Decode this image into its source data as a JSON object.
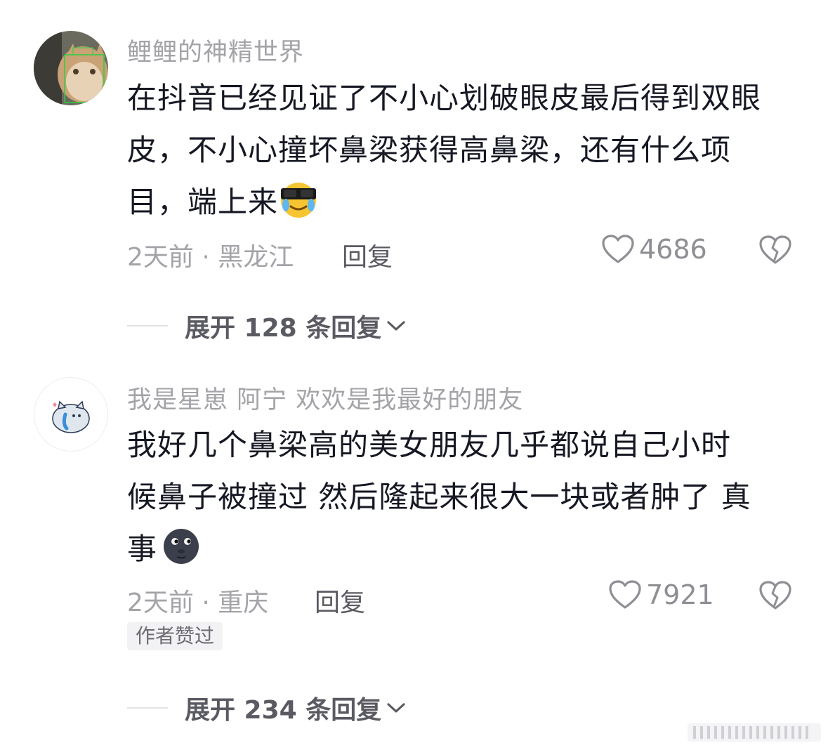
{
  "comments": [
    {
      "username": "鲤鲤的神精世界",
      "text": "在抖音已经见证了不小心划破眼皮最后得到双眼皮，不小心撞坏鼻梁获得高鼻梁，还有什么项目，端上来",
      "emoji": "sunglasses-crying-emoji",
      "time_location": "2天前 · 黑龙江",
      "reply_label": "回复",
      "like_count": "4686",
      "expand_label": "展开 128 条回复"
    },
    {
      "username": "我是星崽 阿宁 欢欢是我最好的朋友",
      "text_line1": "我好几个鼻梁高的美女朋友几乎都说自己小时",
      "text_line2": "候鼻子被撞过 然后隆起来很大一块或者肿了 真",
      "text_line3": "事",
      "emoji": "new-moon-face-emoji",
      "time_location": "2天前 · 重庆",
      "reply_label": "回复",
      "like_count": "7921",
      "badge": "作者赞过",
      "expand_label": "展开 234 条回复"
    }
  ],
  "colors": {
    "text_primary": "#161823",
    "text_secondary": "#a3a3a8",
    "text_action": "#5a5a62",
    "badge_bg": "#f2f2f4"
  }
}
